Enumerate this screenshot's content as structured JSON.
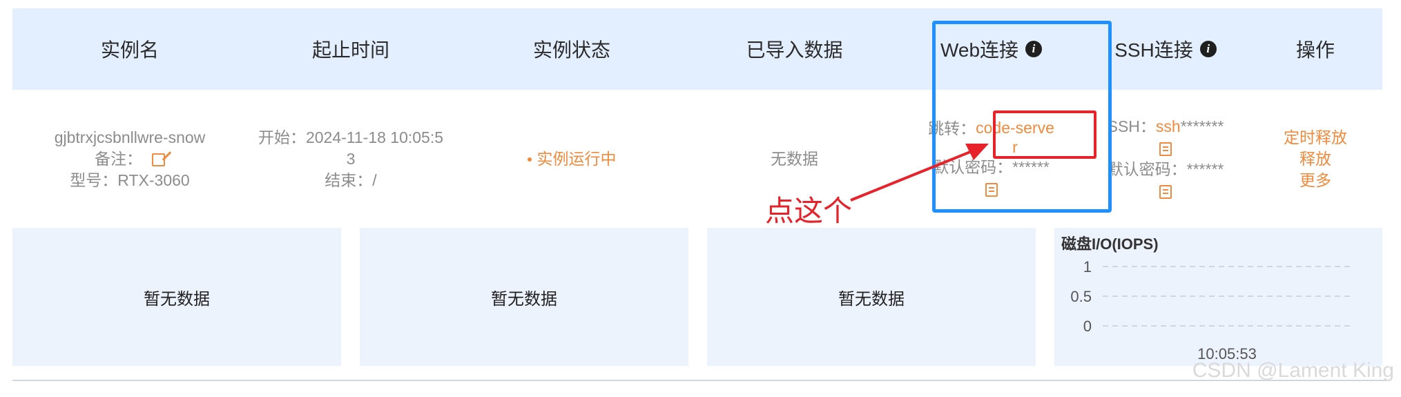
{
  "header": {
    "col_name": "实例名",
    "col_time": "起止时间",
    "col_status": "实例状态",
    "col_data": "已导入数据",
    "col_web": "Web连接",
    "col_ssh": "SSH连接",
    "col_ops": "操作"
  },
  "row": {
    "name": "gjbtrxjcsbnllwre-snow",
    "note_label": "备注：",
    "model": "型号：RTX-3060",
    "start_line1": "开始：2024-11-18 10:05:5",
    "start_line2": "3",
    "end": "结束：/",
    "status": "实例运行中",
    "data": "无数据",
    "web_jump_label": "跳转：",
    "web_link_line1": "code-serve",
    "web_link_line2": "r",
    "web_pwd": "默认密码：******",
    "ssh_label": "SSH：",
    "ssh_value": "ssh",
    "ssh_mask": "*******",
    "ssh_pwd": "默认密码：******",
    "op_timed_release": "定时释放",
    "op_release": "释放",
    "op_more": "更多"
  },
  "annotation": {
    "text": "点这个"
  },
  "panels": {
    "empty1": "暂无数据",
    "empty2": "暂无数据",
    "empty3": "暂无数据"
  },
  "chart_data": {
    "type": "line",
    "title": "磁盘I/O(IOPS)",
    "x": [
      "10:05:53"
    ],
    "y_ticks": [
      "1",
      "0.5",
      "0"
    ],
    "ylim": [
      0,
      1
    ],
    "series": [],
    "grid": true
  },
  "watermark": "CSDN @Lament King",
  "colors": {
    "accent": "#f08a3c",
    "header_bg": "#e3efff",
    "highlight_blue": "#1e90ff",
    "highlight_red": "#e8222a"
  }
}
